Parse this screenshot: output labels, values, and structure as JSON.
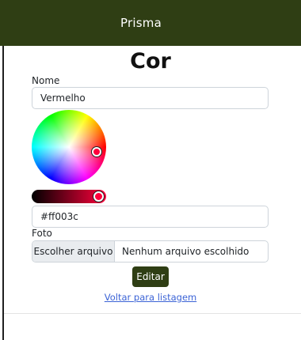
{
  "navbar": {
    "brand": "Prisma"
  },
  "page": {
    "title": "Cor"
  },
  "form": {
    "name_label": "Nome",
    "name_value": "Vermelho",
    "color_hex": "#ff003c",
    "photo_label": "Foto",
    "file_button": "Escolher arquivo",
    "file_status": "Nenhum arquivo escolhido",
    "submit_label": "Editar"
  },
  "links": {
    "back": "Voltar para listagem"
  },
  "colors": {
    "brand": "#2f3e14",
    "selected": "#ff003c",
    "link": "#3b63d6"
  }
}
